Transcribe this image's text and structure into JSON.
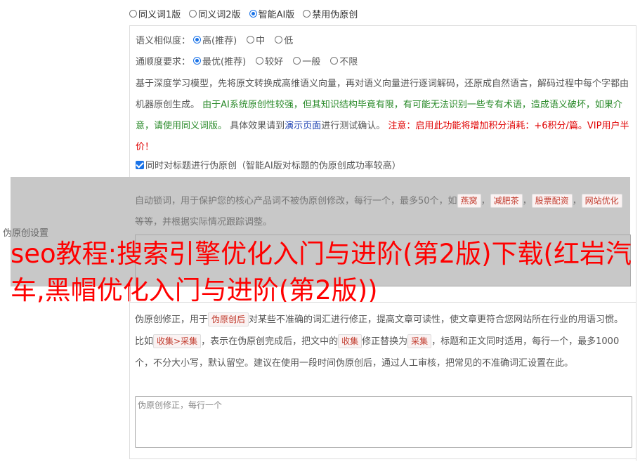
{
  "modes": [
    {
      "label": "同义词1版",
      "checked": false
    },
    {
      "label": "同义词2版",
      "checked": false
    },
    {
      "label": "智能AI版",
      "checked": true
    },
    {
      "label": "禁用伪原创",
      "checked": false
    }
  ],
  "similarity": {
    "label": "语义相似度：",
    "options": [
      {
        "label": "高(推荐)",
        "checked": true
      },
      {
        "label": "中",
        "checked": false
      },
      {
        "label": "低",
        "checked": false
      }
    ]
  },
  "fluency": {
    "label": "通顺度要求：",
    "options": [
      {
        "label": "最优(推荐)",
        "checked": true
      },
      {
        "label": "较好",
        "checked": false
      },
      {
        "label": "一般",
        "checked": false
      },
      {
        "label": "不限",
        "checked": false
      }
    ]
  },
  "description": {
    "part1": "基于深度学习模型，先将原文转换成高维语义向量，再对语义向量进行逐词解码，还原成自然语言，解码过程中每个字都由机器原创生成。",
    "part2_green": "由于AI系统原创性较强，但其知识结构毕竟有限，有可能无法识别一些专有术语，造成语义破坏，如果介意，请使用同义词版。",
    "part3": "具体效果请到",
    "link": "演示页面",
    "part4": "进行测试确认。",
    "part5_red": "注意：启用此功能将增加积分消耗：+6积分/篇。VIP用户半价！"
  },
  "title_checkbox": {
    "checked": true,
    "label": "同时对标题进行伪原创（智能AI版对标题的伪原创成功率较高）"
  },
  "lock_words": {
    "text1": "自动锁词，用于保护您的核心产品词不被伪原创修改，每行一个，最多50个，如",
    "examples": [
      "燕窝",
      "减肥茶",
      "股票配资",
      "网站优化"
    ],
    "text2": "等等，并根据实际情况跟踪调整。"
  },
  "section_label": "伪原创设置",
  "overlay_title": "seo教程:搜索引擎优化入门与进阶(第2版)下载(红岩汽车,黑帽优化入门与进阶(第2版))",
  "correction": {
    "text1": "伪原创修正，用于",
    "tag1": "伪原创后",
    "text2": "对某些不准确的词汇进行修正，提高文章可读性，使文章更符合您网站所在行业的用语习惯。比如",
    "tag2": "收集>采集",
    "text3": "，表示在伪原创完成后，把文中的",
    "tag3": "收集",
    "text4": "修正替换为",
    "tag4": "采集",
    "text5": "，标题和正文同时适用，每行一个，最多1000个，不分大小写，默认留空。建议在使用一段时间伪原创后，通过人工审核，把常见的不准确词汇设置在此。",
    "placeholder": "伪原创修正，每行一个"
  }
}
